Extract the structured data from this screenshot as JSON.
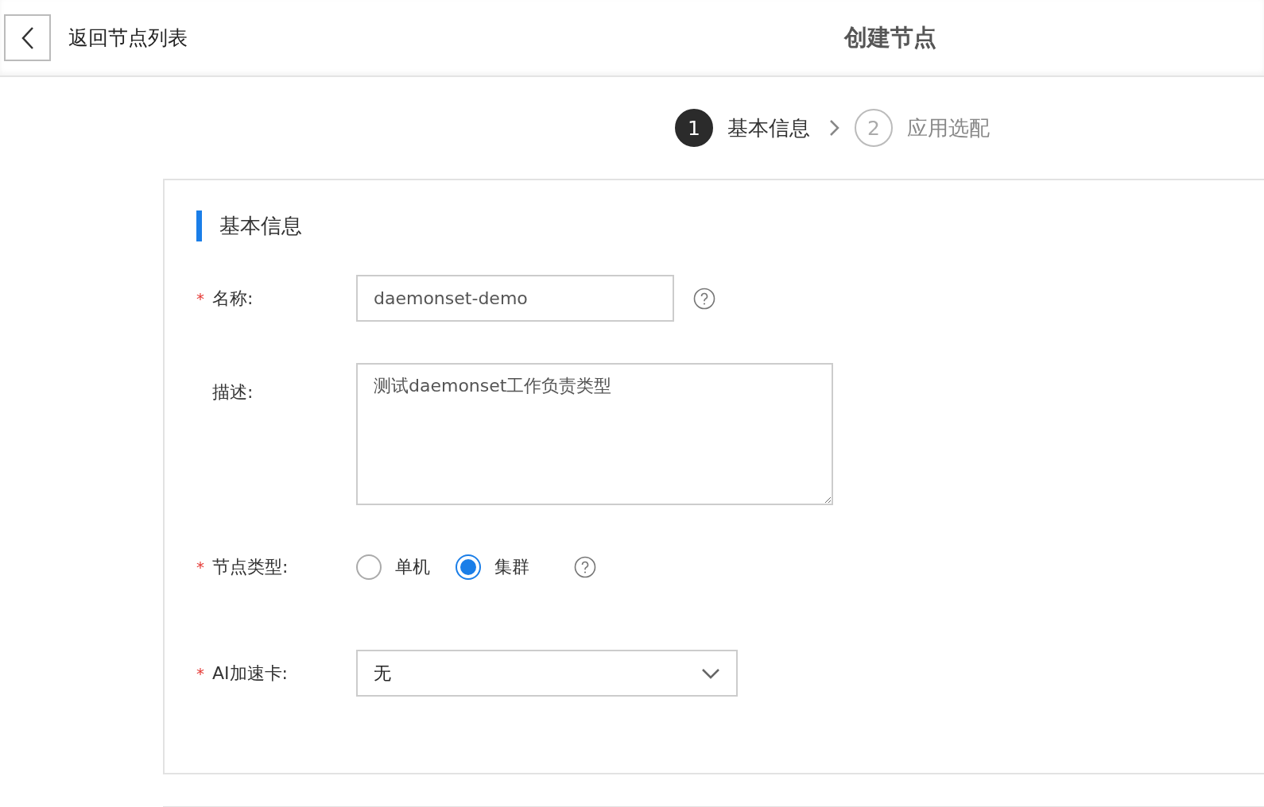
{
  "header": {
    "back_label": "返回节点列表",
    "title": "创建节点"
  },
  "steps": [
    {
      "number": "1",
      "label": "基本信息",
      "selected": true
    },
    {
      "number": "2",
      "label": "应用选配",
      "selected": false
    }
  ],
  "section": {
    "title": "基本信息"
  },
  "fields": [
    {
      "kind": "input",
      "label": "名称:",
      "required_mark": "*",
      "value": "daemonset-demo",
      "help": true
    },
    {
      "kind": "textarea",
      "label": "描述:",
      "value": "测试daemonset工作负责类型",
      "help": false
    },
    {
      "kind": "radio",
      "label": "节点类型:",
      "required_mark": "*",
      "help": true,
      "options": [
        {
          "label": "单机",
          "selected": false
        },
        {
          "label": "集群",
          "selected": true
        }
      ]
    },
    {
      "kind": "select",
      "label": "AI加速卡:",
      "required_mark": "*",
      "value": "无",
      "help": false
    }
  ]
}
